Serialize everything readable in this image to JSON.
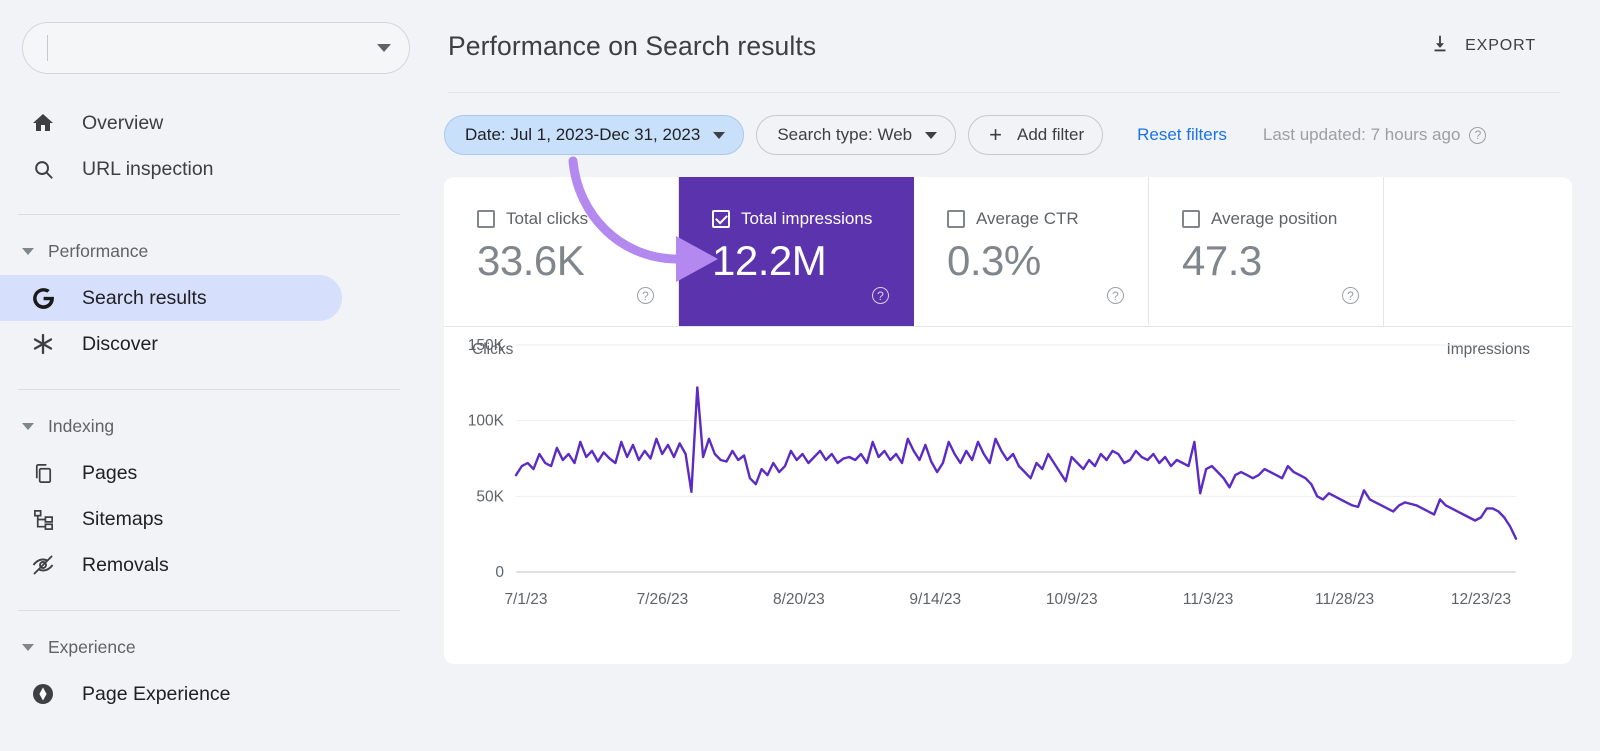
{
  "sidebar": {
    "property_selector": {
      "value": "",
      "placeholder": ""
    },
    "items": [
      {
        "label": "Overview",
        "icon": "home-icon"
      },
      {
        "label": "URL inspection",
        "icon": "search-icon"
      }
    ],
    "groups": [
      {
        "label": "Performance",
        "items": [
          {
            "label": "Search results",
            "icon": "google-g-icon",
            "active": true
          },
          {
            "label": "Discover",
            "icon": "asterisk-icon",
            "active": false
          }
        ]
      },
      {
        "label": "Indexing",
        "items": [
          {
            "label": "Pages",
            "icon": "pages-icon",
            "active": false
          },
          {
            "label": "Sitemaps",
            "icon": "sitemaps-icon",
            "active": false
          },
          {
            "label": "Removals",
            "icon": "eye-off-icon",
            "active": false
          }
        ]
      },
      {
        "label": "Experience",
        "items": [
          {
            "label": "Page Experience",
            "icon": "page-experience-icon",
            "active": false
          }
        ]
      }
    ]
  },
  "header": {
    "title": "Performance on Search results",
    "export_label": "EXPORT",
    "export_icon": "download-icon"
  },
  "filters": {
    "date_chip": "Date: Jul 1, 2023-Dec 31, 2023",
    "search_type_chip": "Search type: Web",
    "add_filter_label": "Add filter",
    "reset_label": "Reset filters",
    "last_updated": "Last updated: 7 hours ago",
    "help_glyph": "?"
  },
  "metrics": [
    {
      "label": "Total clicks",
      "value": "33.6K",
      "selected": false
    },
    {
      "label": "Total impressions",
      "value": "12.2M",
      "selected": true
    },
    {
      "label": "Average CTR",
      "value": "0.3%",
      "selected": false
    },
    {
      "label": "Average position",
      "value": "47.3",
      "selected": false
    }
  ],
  "colors": {
    "selected_card": "#5b33ad",
    "line": "#5b2bc4",
    "active_nav": "#d6dffb",
    "active_chip": "#c9e0fb",
    "link": "#1a73e8",
    "annotation_arrow": "#b389f0"
  },
  "chart_data": {
    "type": "line",
    "title": "",
    "xlabel": "",
    "ylabel": "Clicks",
    "y2label": "Impressions",
    "grid": true,
    "legend": "none",
    "ylim": [
      0,
      150000
    ],
    "ytick_labels": [
      "150K",
      "100K",
      "50K",
      "0"
    ],
    "ytick_values": [
      150000,
      100000,
      50000,
      0
    ],
    "xtick_labels": [
      "7/1/23",
      "7/26/23",
      "8/20/23",
      "9/14/23",
      "10/9/23",
      "11/3/23",
      "11/28/23",
      "12/23/23"
    ],
    "series": [
      {
        "name": "Impressions",
        "color": "#5b2bc4",
        "values": [
          64000,
          70000,
          72000,
          68000,
          78000,
          72000,
          70000,
          82000,
          74000,
          78000,
          72000,
          86000,
          76000,
          80000,
          73000,
          79000,
          75000,
          72000,
          86000,
          76000,
          84000,
          74000,
          80000,
          75000,
          88000,
          78000,
          84000,
          76000,
          85000,
          78000,
          53000,
          122000,
          76000,
          88000,
          78000,
          74000,
          73000,
          80000,
          74000,
          77000,
          62000,
          58000,
          68000,
          64000,
          72000,
          66000,
          70000,
          80000,
          74000,
          78000,
          72000,
          76000,
          80000,
          74000,
          78000,
          72000,
          75000,
          76000,
          74000,
          78000,
          72000,
          86000,
          76000,
          80000,
          74000,
          78000,
          72000,
          88000,
          80000,
          74000,
          84000,
          73000,
          66000,
          72000,
          86000,
          78000,
          72000,
          80000,
          74000,
          86000,
          78000,
          72000,
          88000,
          80000,
          74000,
          78000,
          70000,
          66000,
          62000,
          72000,
          68000,
          78000,
          72000,
          66000,
          60000,
          76000,
          72000,
          68000,
          74000,
          70000,
          78000,
          74000,
          80000,
          78000,
          72000,
          74000,
          80000,
          76000,
          74000,
          78000,
          72000,
          76000,
          70000,
          74000,
          72000,
          70000,
          86000,
          52000,
          68000,
          70000,
          66000,
          62000,
          56000,
          64000,
          66000,
          64000,
          62000,
          64000,
          68000,
          66000,
          64000,
          62000,
          70000,
          66000,
          64000,
          62000,
          58000,
          50000,
          48000,
          52000,
          50000,
          48000,
          46000,
          44000,
          43000,
          54000,
          48000,
          46000,
          44000,
          42000,
          40000,
          44000,
          46000,
          45000,
          44000,
          42000,
          40000,
          38000,
          48000,
          44000,
          42000,
          40000,
          38000,
          36000,
          34000,
          36000,
          42000,
          42000,
          40000,
          36000,
          30000,
          22000
        ]
      }
    ]
  }
}
